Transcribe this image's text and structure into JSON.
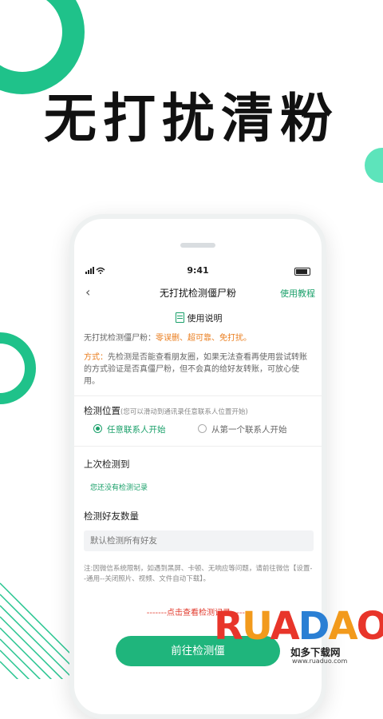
{
  "hero_title": "无打扰清粉",
  "status": {
    "time": "9:41"
  },
  "nav": {
    "back": "‹",
    "title": "无打扰检测僵尸粉",
    "guide": "使用教程"
  },
  "instructions": {
    "title": "使用说明",
    "line_prefix": "无打扰检测僵尸粉：",
    "line_highlight": "零误删、超可靠、免打扰。",
    "method_label": "方式：",
    "method_text": "先检测是否能查看朋友圈，如果无法查看再使用尝试转账的方式验证是否真僵尸粉，但不会真的给好友转账，可放心使用。"
  },
  "position": {
    "label": "检测位置",
    "hint": "(您可以滑动到通讯录任意联系人位置开始)",
    "options": [
      "任意联系人开始",
      "从第一个联系人开始"
    ],
    "selected": "任意联系人开始"
  },
  "last_check": {
    "label": "上次检测到",
    "empty": "您还没有检测记录"
  },
  "friend_count": {
    "label": "检测好友数量",
    "placeholder": "默认检测所有好友"
  },
  "note": "注:因微信系统限制，如遇到黑屏、卡顿、无响应等问题，请前往微信【设置--通用--关闭照片、视频、文件自动下载】。",
  "record_link": "-------点击查看检测记录-------",
  "start_button": "前往检测僵",
  "watermark": {
    "logo": "RUANDAO",
    "subtitle": "如多下载网",
    "url": "www.ruaduo.com"
  },
  "colors": {
    "accent": "#1fb57c",
    "mint": "#5de4bb",
    "link_red": "#e23b2e",
    "highlight_orange": "#ea7d1e"
  }
}
